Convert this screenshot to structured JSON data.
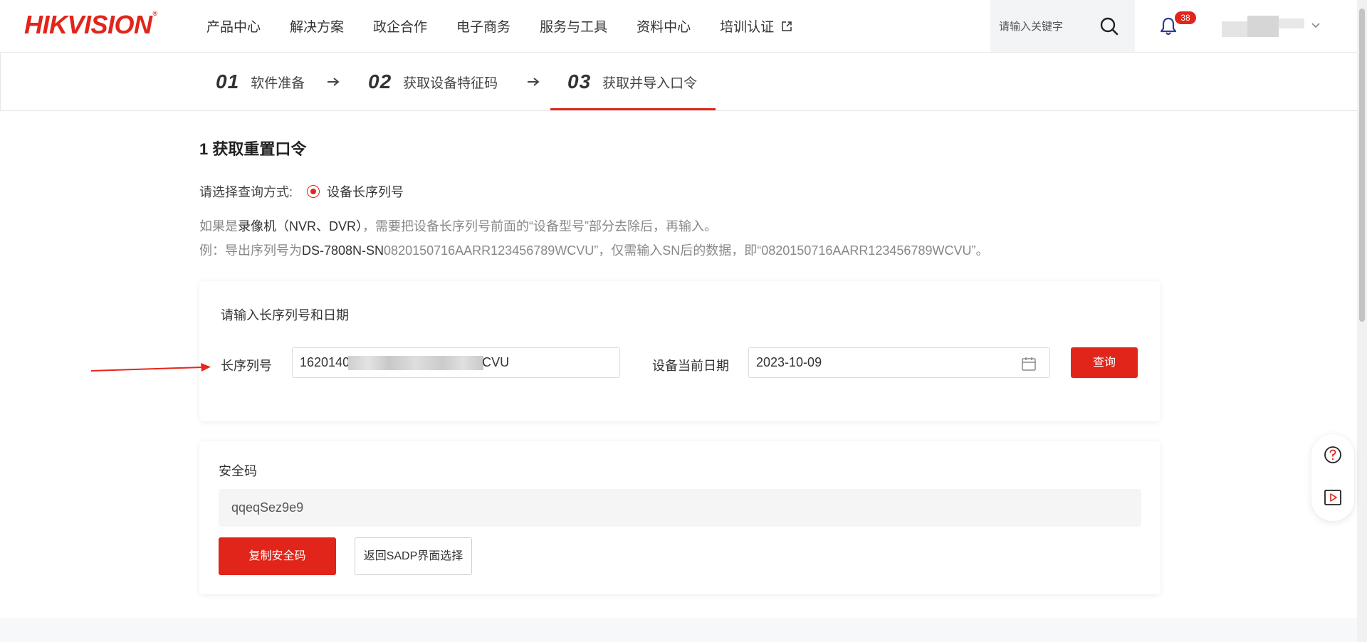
{
  "header": {
    "logo": "HIKVISION",
    "logo_reg": "®",
    "nav": [
      "产品中心",
      "解决方案",
      "政企合作",
      "电子商务",
      "服务与工具",
      "资料中心",
      "培训认证"
    ],
    "search_placeholder": "请输入关键字",
    "notification_count": "38"
  },
  "steps": [
    {
      "num": "01",
      "label": "软件准备"
    },
    {
      "num": "02",
      "label": "获取设备特征码"
    },
    {
      "num": "03",
      "label": "获取并导入口令",
      "active": true
    }
  ],
  "main": {
    "title": "1 获取重置口令",
    "query_label": "请选择查询方式:",
    "radio_label": "设备长序列号",
    "hint1_a": "如果是",
    "hint1_b": "录像机（NVR、DVR）",
    "hint1_c": "，需要把设备长序列号前面的“设备型号”部分去除后，再输入。",
    "hint2_a": "例：导出序列号为",
    "hint2_b": "DS-7808N-SN",
    "hint2_c": "0820150716AARR123456789WCVU”，仅需输入SN后的数据，即“0820150716AARR123456789WCVU”。"
  },
  "form": {
    "card_title": "请输入长序列号和日期",
    "serial_label": "长序列号",
    "serial_prefix": "1620140",
    "serial_suffix": "CVU",
    "date_label": "设备当前日期",
    "date_value": "2023-10-09",
    "query_button": "查询"
  },
  "result": {
    "title": "安全码",
    "code": "qqeqSez9e9",
    "copy_button": "复制安全码",
    "back_button": "返回SADP界面选择"
  },
  "colors": {
    "accent": "#e1251b",
    "annotation_arrow": "#e8251c"
  }
}
